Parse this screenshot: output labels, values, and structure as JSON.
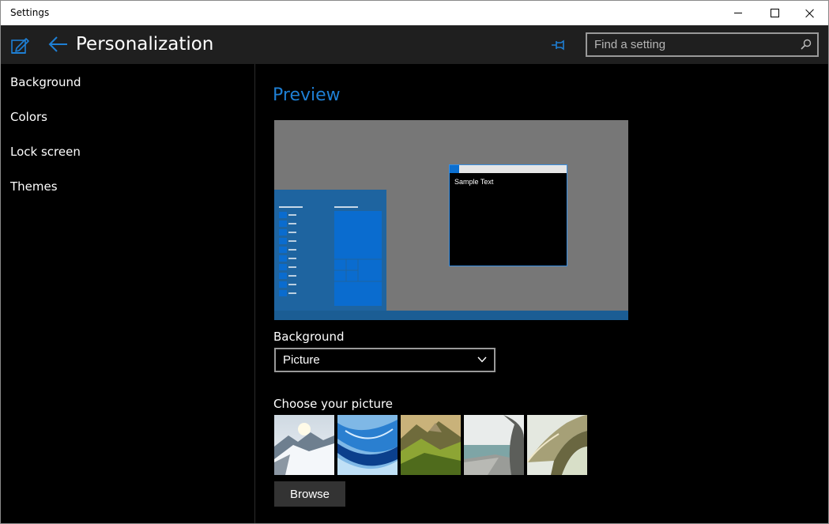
{
  "window": {
    "title": "Settings"
  },
  "header": {
    "page_title": "Personalization",
    "search_placeholder": "Find a setting",
    "accent_color": "#1e7fd4"
  },
  "sidebar": {
    "items": [
      {
        "label": "Background"
      },
      {
        "label": "Colors"
      },
      {
        "label": "Lock screen"
      },
      {
        "label": "Themes"
      }
    ]
  },
  "main": {
    "preview_heading": "Preview",
    "preview_sample_text": "Sample Text",
    "background_label": "Background",
    "background_value": "Picture",
    "choose_label": "Choose your picture",
    "browse_label": "Browse",
    "thumbnails": [
      {
        "icon": "snowy-mountain-image"
      },
      {
        "icon": "blue-ice-wave-image"
      },
      {
        "icon": "green-cliffs-image"
      },
      {
        "icon": "coastal-rock-image"
      },
      {
        "icon": "sand-sea-abstract-image"
      }
    ]
  },
  "icons": {
    "app": "edit-settings-icon",
    "back": "back-arrow-icon",
    "pin": "pin-icon",
    "search": "search-icon",
    "dropdown": "chevron-down-icon"
  }
}
